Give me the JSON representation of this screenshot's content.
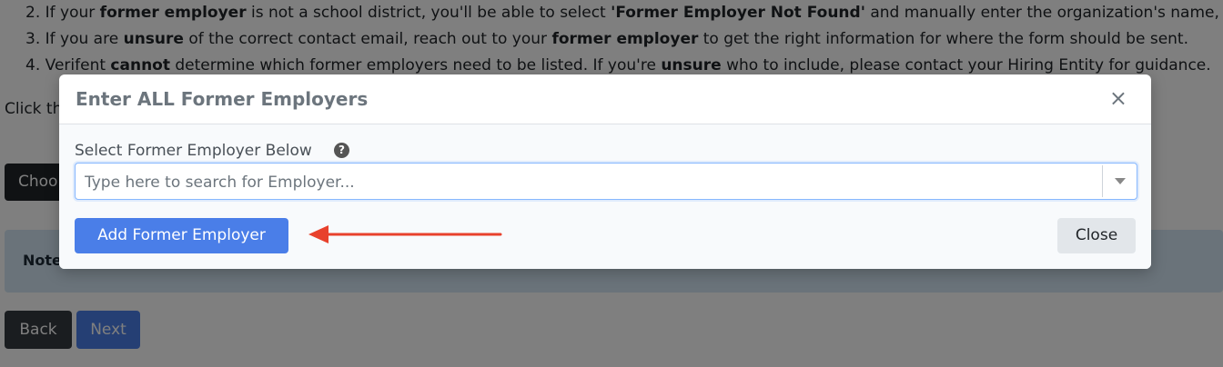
{
  "background": {
    "instructions": [
      {
        "num": "2.",
        "parts": [
          "If your ",
          "former employer",
          " is not a school district, you'll be able to select ",
          "'Former Employer Not Found'",
          " and manually enter the organization's name, co"
        ]
      },
      {
        "num": "3.",
        "parts": [
          "If you are ",
          "unsure",
          " of the correct contact email, reach out to your ",
          "former employer",
          " to get the right information for where the form should be sent."
        ]
      },
      {
        "num": "4.",
        "parts": [
          "Verifent ",
          "cannot",
          " determine which former employers need to be listed. If you're ",
          "unsure",
          " who to include, please contact your Hiring Entity for guidance."
        ]
      }
    ],
    "click_text": "Click th",
    "choose_label": "Choo",
    "note_label": "Note",
    "back_label": "Back",
    "next_label": "Next"
  },
  "modal": {
    "title": "Enter ALL Former Employers",
    "close_x": "×",
    "field_label": "Select Former Employer Below",
    "help_icon": "?",
    "search_placeholder": "Type here to search for Employer...",
    "add_button": "Add Former Employer",
    "close_button": "Close"
  },
  "colors": {
    "primary": "#4a7ee8",
    "annotation_arrow": "#e8412c",
    "dark_button": "#343a40"
  }
}
